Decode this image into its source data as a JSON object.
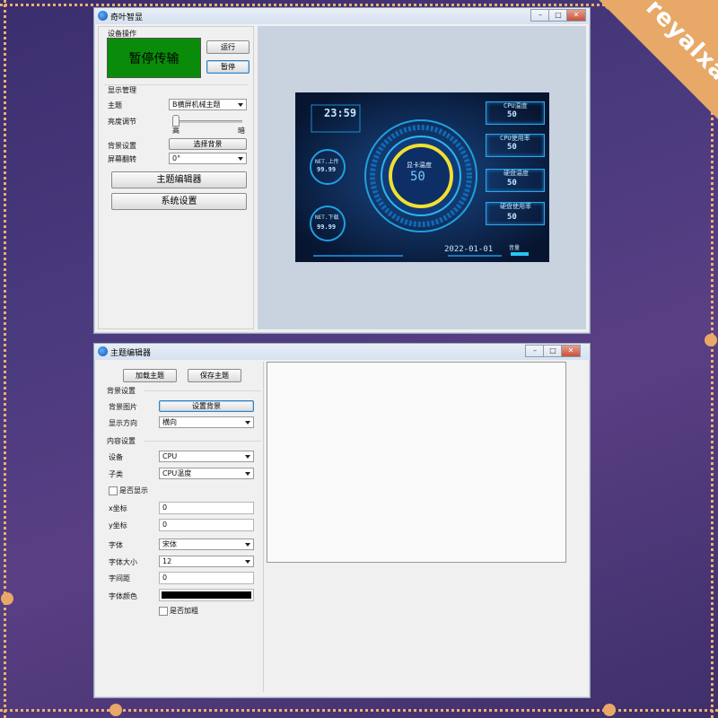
{
  "watermark": "reyalxa",
  "main_window": {
    "title": "奇叶智显",
    "device_ops": {
      "section_label": "设备操作",
      "status_text": "暂停传输",
      "status_color": "#0a8c0a",
      "run_button": "运行",
      "pause_button": "暂停"
    },
    "display": {
      "section_label": "显示管理",
      "theme_label": "主题",
      "theme_value": "B横屏机械主题",
      "brightness_label": "亮度调节",
      "brightness_high": "高",
      "brightness_low": "暗",
      "brightness_level": 0.0,
      "bg_label": "背景设置",
      "bg_button": "选择背景",
      "rotate_label": "屏幕翻转",
      "rotate_value": "0°",
      "theme_editor_button": "主题编辑器",
      "system_settings_button": "系统设置"
    },
    "preview": {
      "time": "23:59",
      "net_up_label": "NET.上传",
      "net_up_value": "99.99",
      "net_down_label": "NET.下载",
      "net_down_value": "99.99",
      "gpu_temp_label": "显卡温度",
      "gpu_temp_value": "50",
      "cpu_temp_label": "CPU温度",
      "cpu_temp_value": "50",
      "cpu_usage_label": "CPU使用率",
      "cpu_usage_value": "50",
      "disk_temp_label": "硬盘温度",
      "disk_temp_value": "50",
      "disk_usage_label": "硬盘使用率",
      "disk_usage_value": "50",
      "date": "2022-01-01",
      "volume_label": "音量"
    }
  },
  "editor_window": {
    "title": "主题编辑器",
    "load_button": "加载主题",
    "save_button": "保存主题",
    "background": {
      "section_label": "背景设置",
      "image_label": "背景图片",
      "image_button": "设置背景",
      "orientation_label": "显示方向",
      "orientation_value": "横向"
    },
    "content": {
      "section_label": "内容设置",
      "device_label": "设备",
      "device_value": "CPU",
      "subtype_label": "子类",
      "subtype_value": "CPU温度",
      "show_label": "是否显示",
      "x_label": "x坐标",
      "x_value": "0",
      "y_label": "y坐标",
      "y_value": "0",
      "font_label": "字体",
      "font_value": "宋体",
      "font_size_label": "字体大小",
      "font_size_value": "12",
      "spacing_label": "字间距",
      "spacing_value": "0",
      "color_label": "字体颜色",
      "color_value": "#000000",
      "bold_label": "是否加粗"
    }
  }
}
